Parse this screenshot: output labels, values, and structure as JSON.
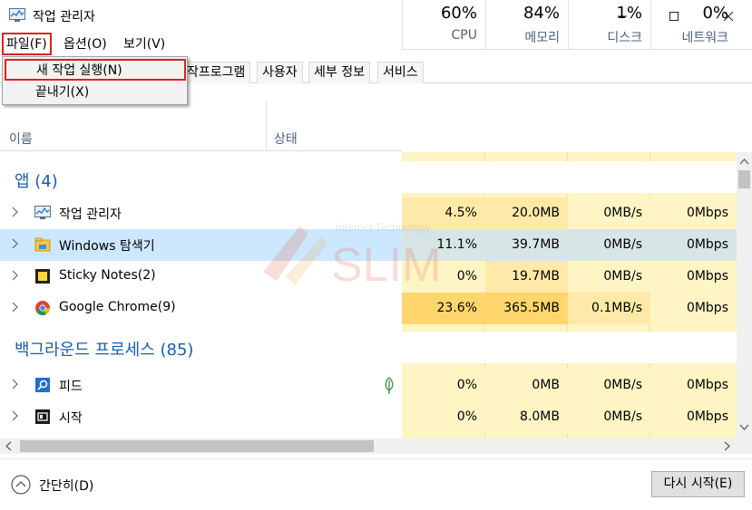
{
  "window": {
    "title": "작업 관리자",
    "min": "—",
    "max": "☐",
    "close": "✕"
  },
  "menu": {
    "file": "파일(F)",
    "options": "옵션(O)",
    "view": "보기(V)"
  },
  "dropdown": {
    "new_task": "새 작업 실행(N)",
    "exit": "끝내기(X)"
  },
  "tabs": [
    "작프로그램",
    "사용자",
    "세부 정보",
    "서비스"
  ],
  "columns": {
    "name": "이름",
    "status": "상태",
    "cpu": {
      "pct": "60%",
      "label": "CPU"
    },
    "memory": {
      "pct": "84%",
      "label": "메모리"
    },
    "disk": {
      "pct": "1%",
      "label": "디스크"
    },
    "network": {
      "pct": "0%",
      "label": "네트워크"
    }
  },
  "groups": {
    "apps": "앱 (4)",
    "background": "백그라운드 프로세스 (85)"
  },
  "apps": [
    {
      "name": "작업 관리자",
      "icon": "task-manager-icon",
      "cpu": "4.5%",
      "mem": "20.0MB",
      "disk": "0MB/s",
      "net": "0Mbps"
    },
    {
      "name": "Windows 탐색기",
      "icon": "file-explorer-icon",
      "cpu": "11.1%",
      "mem": "39.7MB",
      "disk": "0MB/s",
      "net": "0Mbps"
    },
    {
      "name": "Sticky Notes(2)",
      "icon": "sticky-notes-icon",
      "cpu": "0%",
      "mem": "19.7MB",
      "disk": "0MB/s",
      "net": "0Mbps"
    },
    {
      "name": "Google Chrome(9)",
      "icon": "chrome-icon",
      "cpu": "23.6%",
      "mem": "365.5MB",
      "disk": "0.1MB/s",
      "net": "0Mbps"
    }
  ],
  "background": [
    {
      "name": "피드",
      "icon": "feed-icon",
      "cpu": "0%",
      "mem": "0MB",
      "disk": "0MB/s",
      "net": "0Mbps"
    },
    {
      "name": "시작",
      "icon": "start-icon",
      "cpu": "0%",
      "mem": "8.0MB",
      "disk": "0MB/s",
      "net": "0Mbps"
    }
  ],
  "footer": {
    "fewer": "간단히(D)",
    "restart": "다시 시작(E)"
  },
  "watermark": {
    "line1": "Internet Technology",
    "line2": "SLIM"
  },
  "colors": {
    "cpu_light": "#fff4c4",
    "cpu_mid": "#ffe9a8",
    "cpu_hot": "#ffd66e",
    "selected": "#cce8ff",
    "group": "#1a5fa8"
  }
}
